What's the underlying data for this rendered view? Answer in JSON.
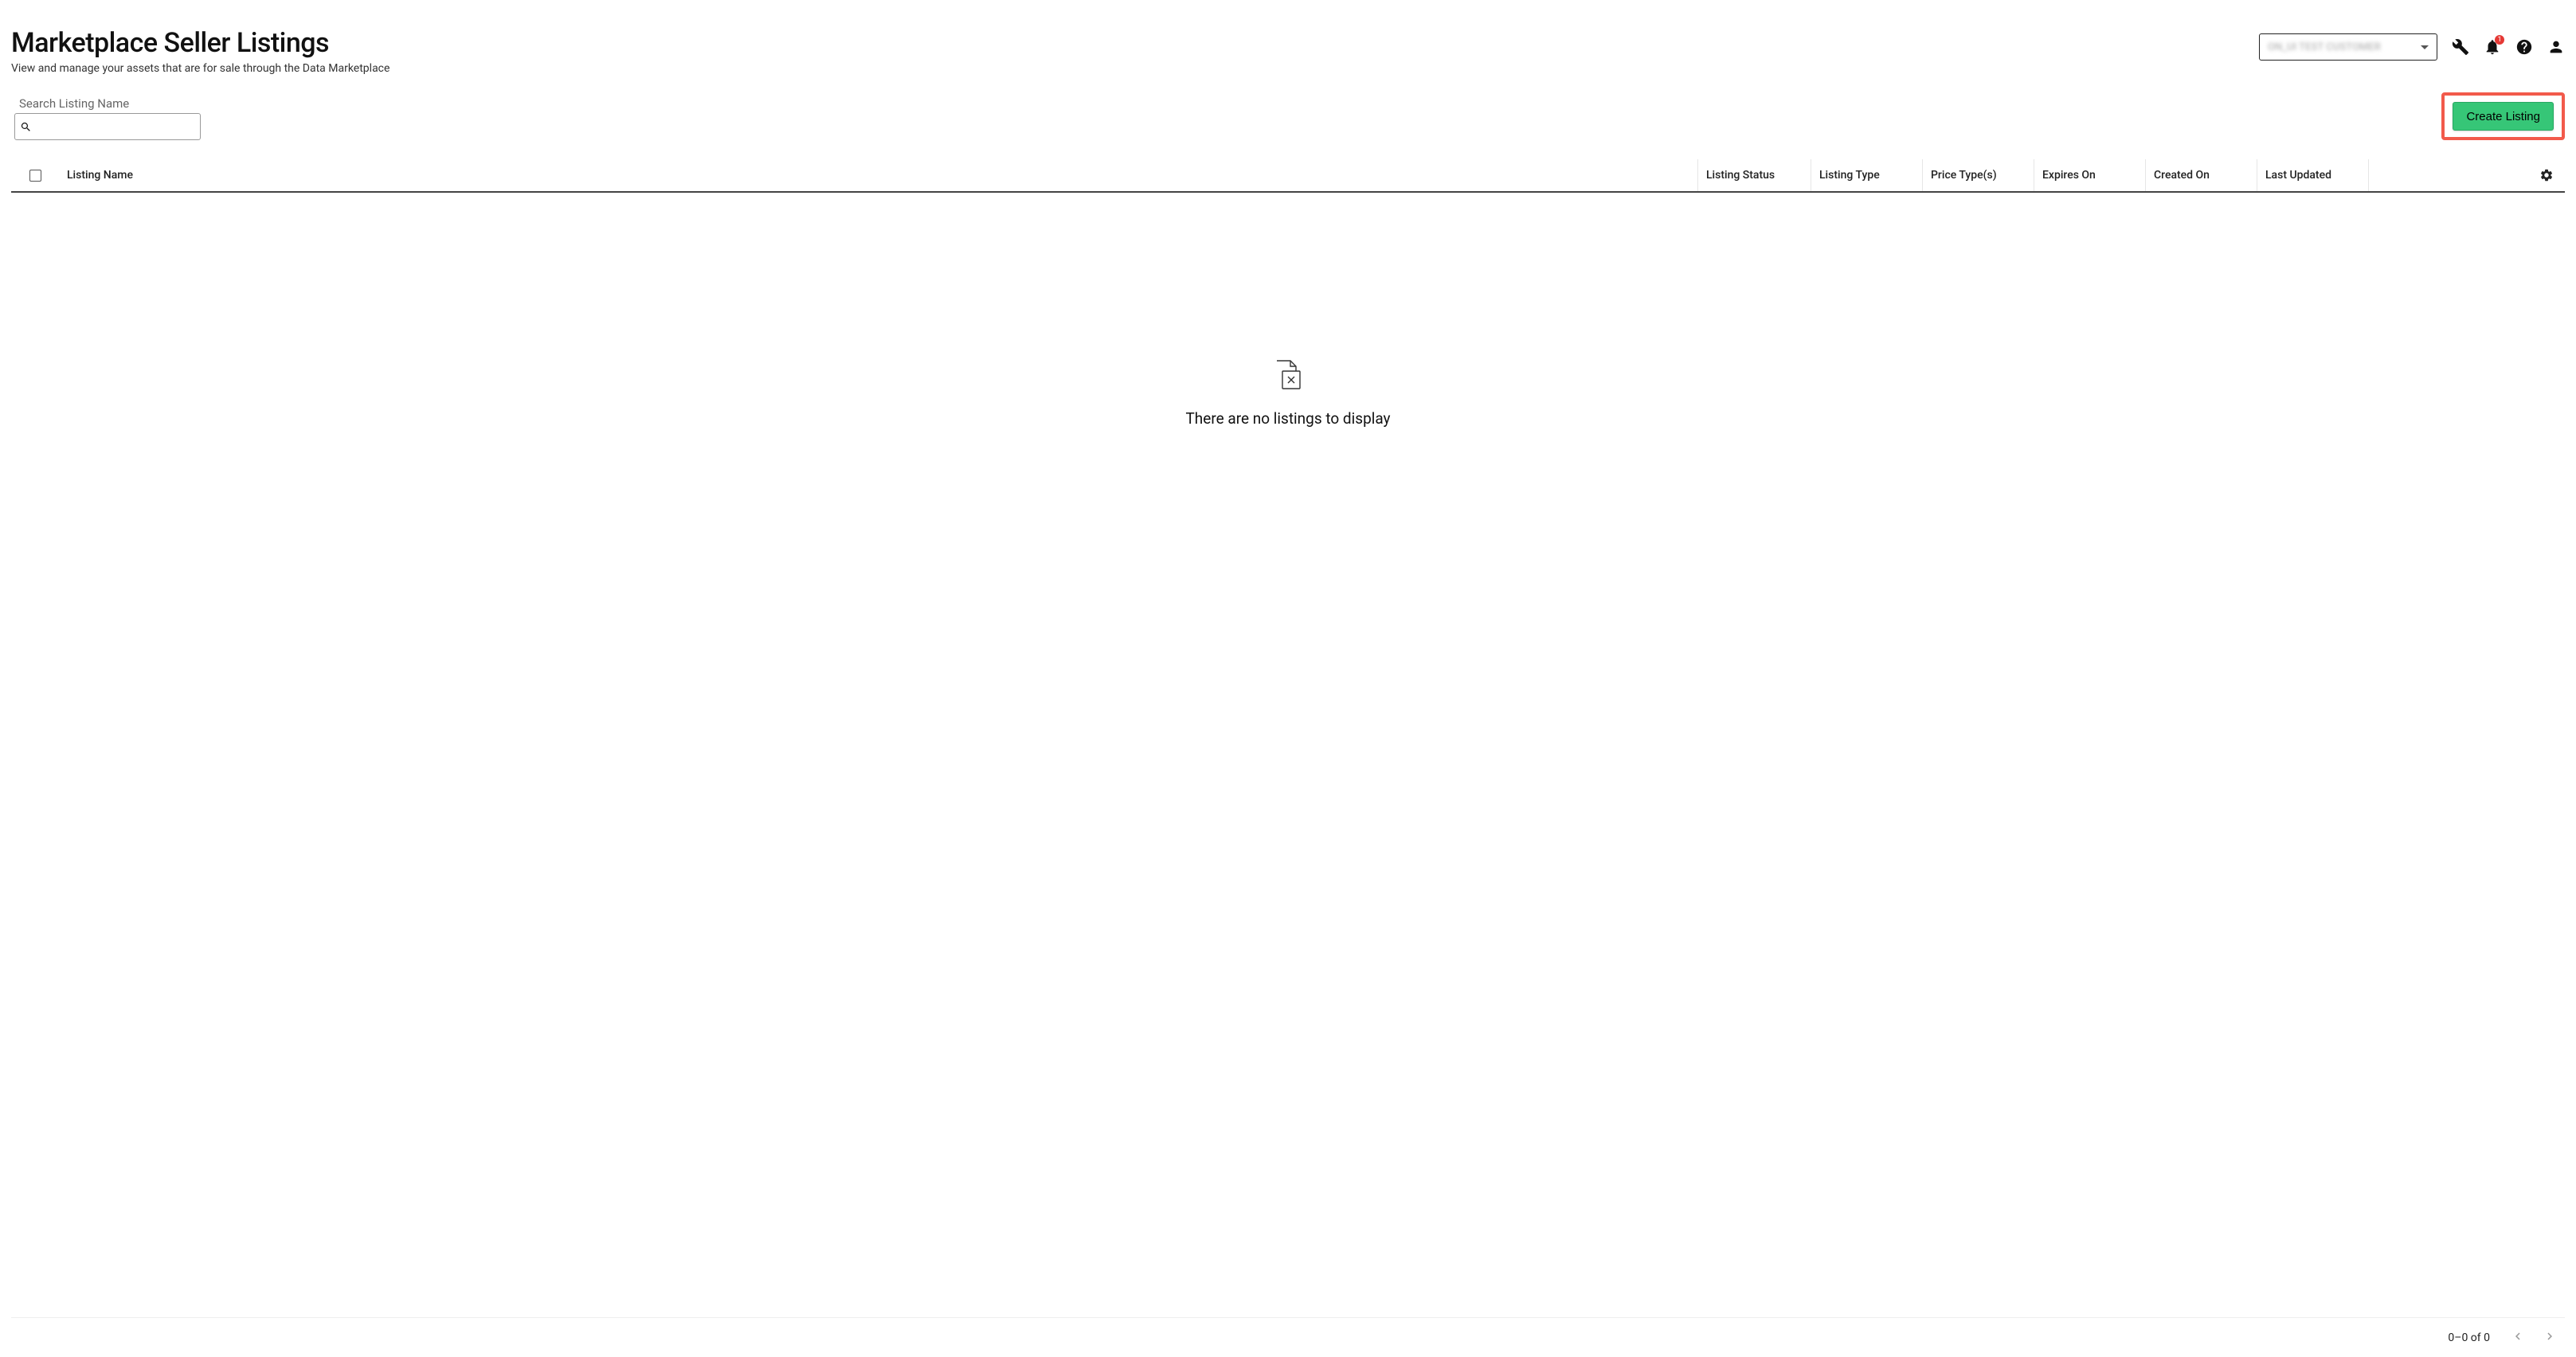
{
  "header": {
    "title": "Marketplace Seller Listings",
    "subtitle": "View and manage your assets that are for sale through the Data Marketplace",
    "customer_select_text": "ON_UI TEST CUSTOMER",
    "notification_count": "1"
  },
  "toolbar": {
    "search_label": "Search Listing Name",
    "search_value": "",
    "create_button": "Create Listing"
  },
  "table": {
    "columns": {
      "listing_name": "Listing Name",
      "listing_status": "Listing Status",
      "listing_type": "Listing Type",
      "price_types": "Price Type(s)",
      "expires_on": "Expires On",
      "created_on": "Created On",
      "last_updated": "Last Updated"
    },
    "empty_message": "There are no listings to display"
  },
  "pagination": {
    "range_text": "0–0 of 0"
  }
}
